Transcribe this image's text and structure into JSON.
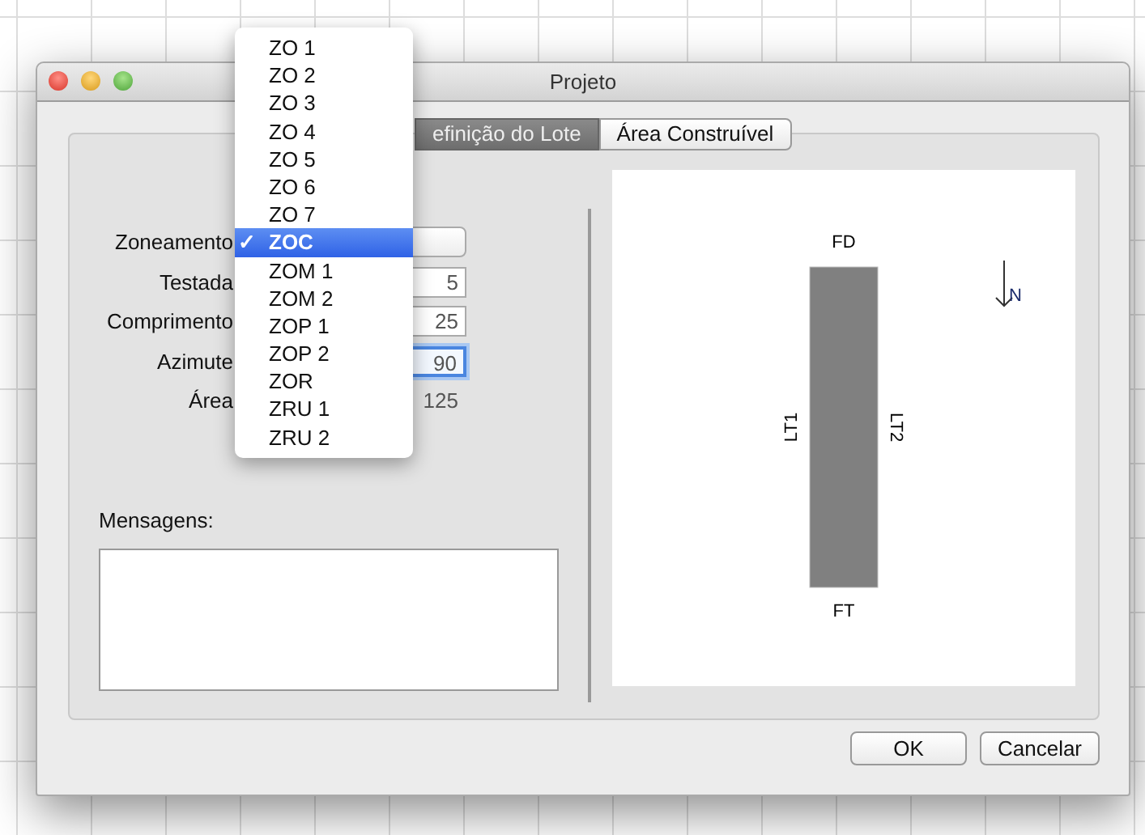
{
  "window": {
    "title": "Projeto"
  },
  "tabs": [
    {
      "label": "efinição do Lote",
      "selected": true
    },
    {
      "label": "Área Construível",
      "selected": false
    }
  ],
  "fields": [
    {
      "label": "Zoneamento",
      "kind": "popup",
      "focused": false
    },
    {
      "label": "Testada",
      "kind": "input",
      "value": "5",
      "focused": false
    },
    {
      "label": "Comprimento",
      "kind": "input",
      "value": "25",
      "focused": false
    },
    {
      "label": "Azimute",
      "kind": "input",
      "value": "90",
      "focused": true
    },
    {
      "label": "Área",
      "kind": "text",
      "value": "125",
      "focused": false
    }
  ],
  "menu": [
    {
      "label": "ZO 1",
      "selected": false
    },
    {
      "label": "ZO 2",
      "selected": false
    },
    {
      "label": "ZO 3",
      "selected": false
    },
    {
      "label": "ZO 4",
      "selected": false
    },
    {
      "label": "ZO 5",
      "selected": false
    },
    {
      "label": "ZO 6",
      "selected": false
    },
    {
      "label": "ZO 7",
      "selected": false
    },
    {
      "label": "ZOC",
      "selected": true,
      "check": "✓"
    },
    {
      "label": "ZOM 1",
      "selected": false
    },
    {
      "label": "ZOM 2",
      "selected": false
    },
    {
      "label": "ZOP 1",
      "selected": false
    },
    {
      "label": "ZOP 2",
      "selected": false
    },
    {
      "label": "ZOR",
      "selected": false
    },
    {
      "label": "ZRU 1",
      "selected": false
    },
    {
      "label": "ZRU 2",
      "selected": false
    }
  ],
  "messages": {
    "label": "Mensagens:"
  },
  "plan": {
    "front_top": "FD",
    "front_bottom": "FT",
    "side_left": "LT1",
    "side_right": "LT2",
    "north": "N"
  },
  "buttons": [
    "OK",
    "Cancelar"
  ]
}
